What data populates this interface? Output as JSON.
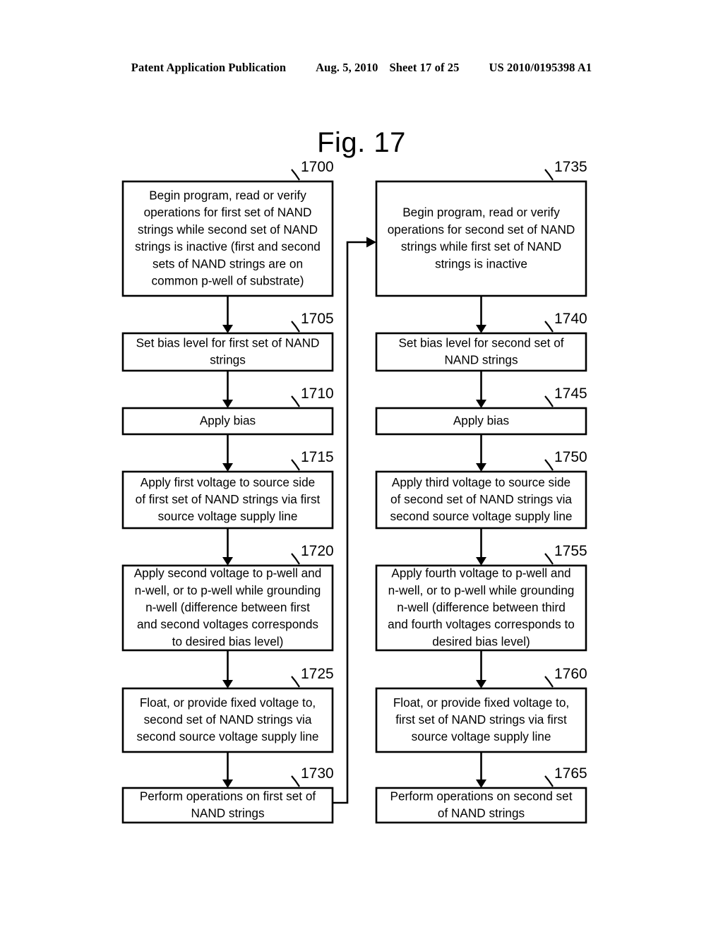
{
  "header": {
    "publication": "Patent Application Publication",
    "date": "Aug. 5, 2010",
    "sheet": "Sheet 17 of 25",
    "patent_number": "US 2010/0195398 A1"
  },
  "figure": {
    "title": "Fig. 17",
    "type": "flowchart",
    "columns": 2,
    "ink_color": "#000000",
    "background_color": "#ffffff"
  },
  "flowchart": {
    "left_column": [
      {
        "ref": "1700",
        "lines": [
          "Begin program, read or verify",
          "operations for first set of NAND",
          "strings while second set of NAND",
          "strings is inactive (first and second",
          "sets of NAND strings are on",
          "common p-well of substrate)"
        ]
      },
      {
        "ref": "1705",
        "lines": [
          "Set bias level for first set of NAND",
          "strings"
        ]
      },
      {
        "ref": "1710",
        "lines": [
          "Apply bias"
        ]
      },
      {
        "ref": "1715",
        "lines": [
          "Apply first voltage to source side",
          "of first set of NAND strings via first",
          "source voltage supply line"
        ]
      },
      {
        "ref": "1720",
        "lines": [
          "Apply second voltage to p-well and",
          "n-well, or to p-well while grounding",
          "n-well (difference between first",
          "and second voltages corresponds",
          "to desired bias level)"
        ]
      },
      {
        "ref": "1725",
        "lines": [
          "Float, or provide fixed voltage to,",
          "second set of NAND strings via",
          "second source voltage supply line"
        ]
      },
      {
        "ref": "1730",
        "lines": [
          "Perform operations on first set of",
          "NAND strings"
        ]
      }
    ],
    "right_column": [
      {
        "ref": "1735",
        "lines": [
          "Begin program, read or verify",
          "operations for second set of NAND",
          "strings while first set of NAND",
          "strings is inactive"
        ]
      },
      {
        "ref": "1740",
        "lines": [
          "Set bias level for second set of",
          "NAND strings"
        ]
      },
      {
        "ref": "1745",
        "lines": [
          "Apply bias"
        ]
      },
      {
        "ref": "1750",
        "lines": [
          "Apply third voltage to source side",
          "of second set of NAND strings via",
          "second source voltage supply line"
        ]
      },
      {
        "ref": "1755",
        "lines": [
          "Apply fourth voltage to p-well and",
          "n-well, or to p-well while grounding",
          "n-well (difference between third",
          "and fourth voltages corresponds to",
          "desired bias level)"
        ]
      },
      {
        "ref": "1760",
        "lines": [
          "Float, or provide fixed voltage to,",
          "first set of NAND strings via first",
          "source voltage supply line"
        ]
      },
      {
        "ref": "1765",
        "lines": [
          "Perform operations on second set",
          "of NAND strings"
        ]
      }
    ],
    "connectors": {
      "feedback_from": "1730",
      "feedback_to": "1735"
    }
  }
}
